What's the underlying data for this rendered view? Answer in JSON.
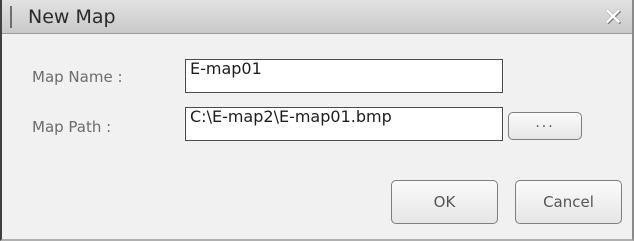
{
  "window": {
    "title": "New Map",
    "close_glyph": "✕"
  },
  "form": {
    "map_name_label": "Map Name :",
    "map_name_value": "E-map01",
    "map_path_label": "Map Path :",
    "map_path_value": "C:\\E-map2\\E-map01.bmp",
    "browse_label": "..."
  },
  "buttons": {
    "ok_label": "OK",
    "cancel_label": "Cancel"
  },
  "icons": {
    "close": "close-icon"
  }
}
